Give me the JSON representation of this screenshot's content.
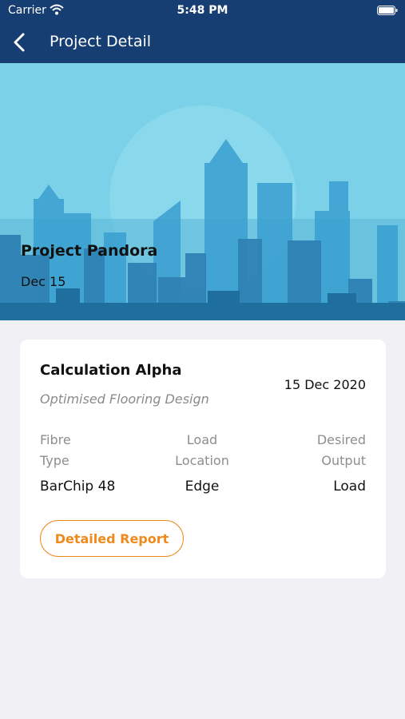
{
  "status_bar": {
    "carrier": "Carrier",
    "time": "5:48 PM"
  },
  "nav": {
    "title": "Project Detail",
    "back_icon": "chevron-left-icon"
  },
  "project": {
    "name": "Project Pandora",
    "date": "Dec 15"
  },
  "calculation": {
    "title": "Calculation Alpha",
    "subtitle": "Optimised Flooring Design",
    "date": "15 Dec 2020",
    "columns": [
      {
        "label_line1": "Fibre",
        "label_line2": "Type",
        "value": "BarChip 48"
      },
      {
        "label_line1": "Load",
        "label_line2": "Location",
        "value": "Edge"
      },
      {
        "label_line1": "Desired",
        "label_line2": "Output",
        "value": "Load"
      }
    ],
    "report_button": "Detailed Report"
  },
  "colors": {
    "header": "#173e72",
    "accent": "#f08a1c",
    "hero_sky": "#77d0e6",
    "background": "#f1f1f5"
  }
}
